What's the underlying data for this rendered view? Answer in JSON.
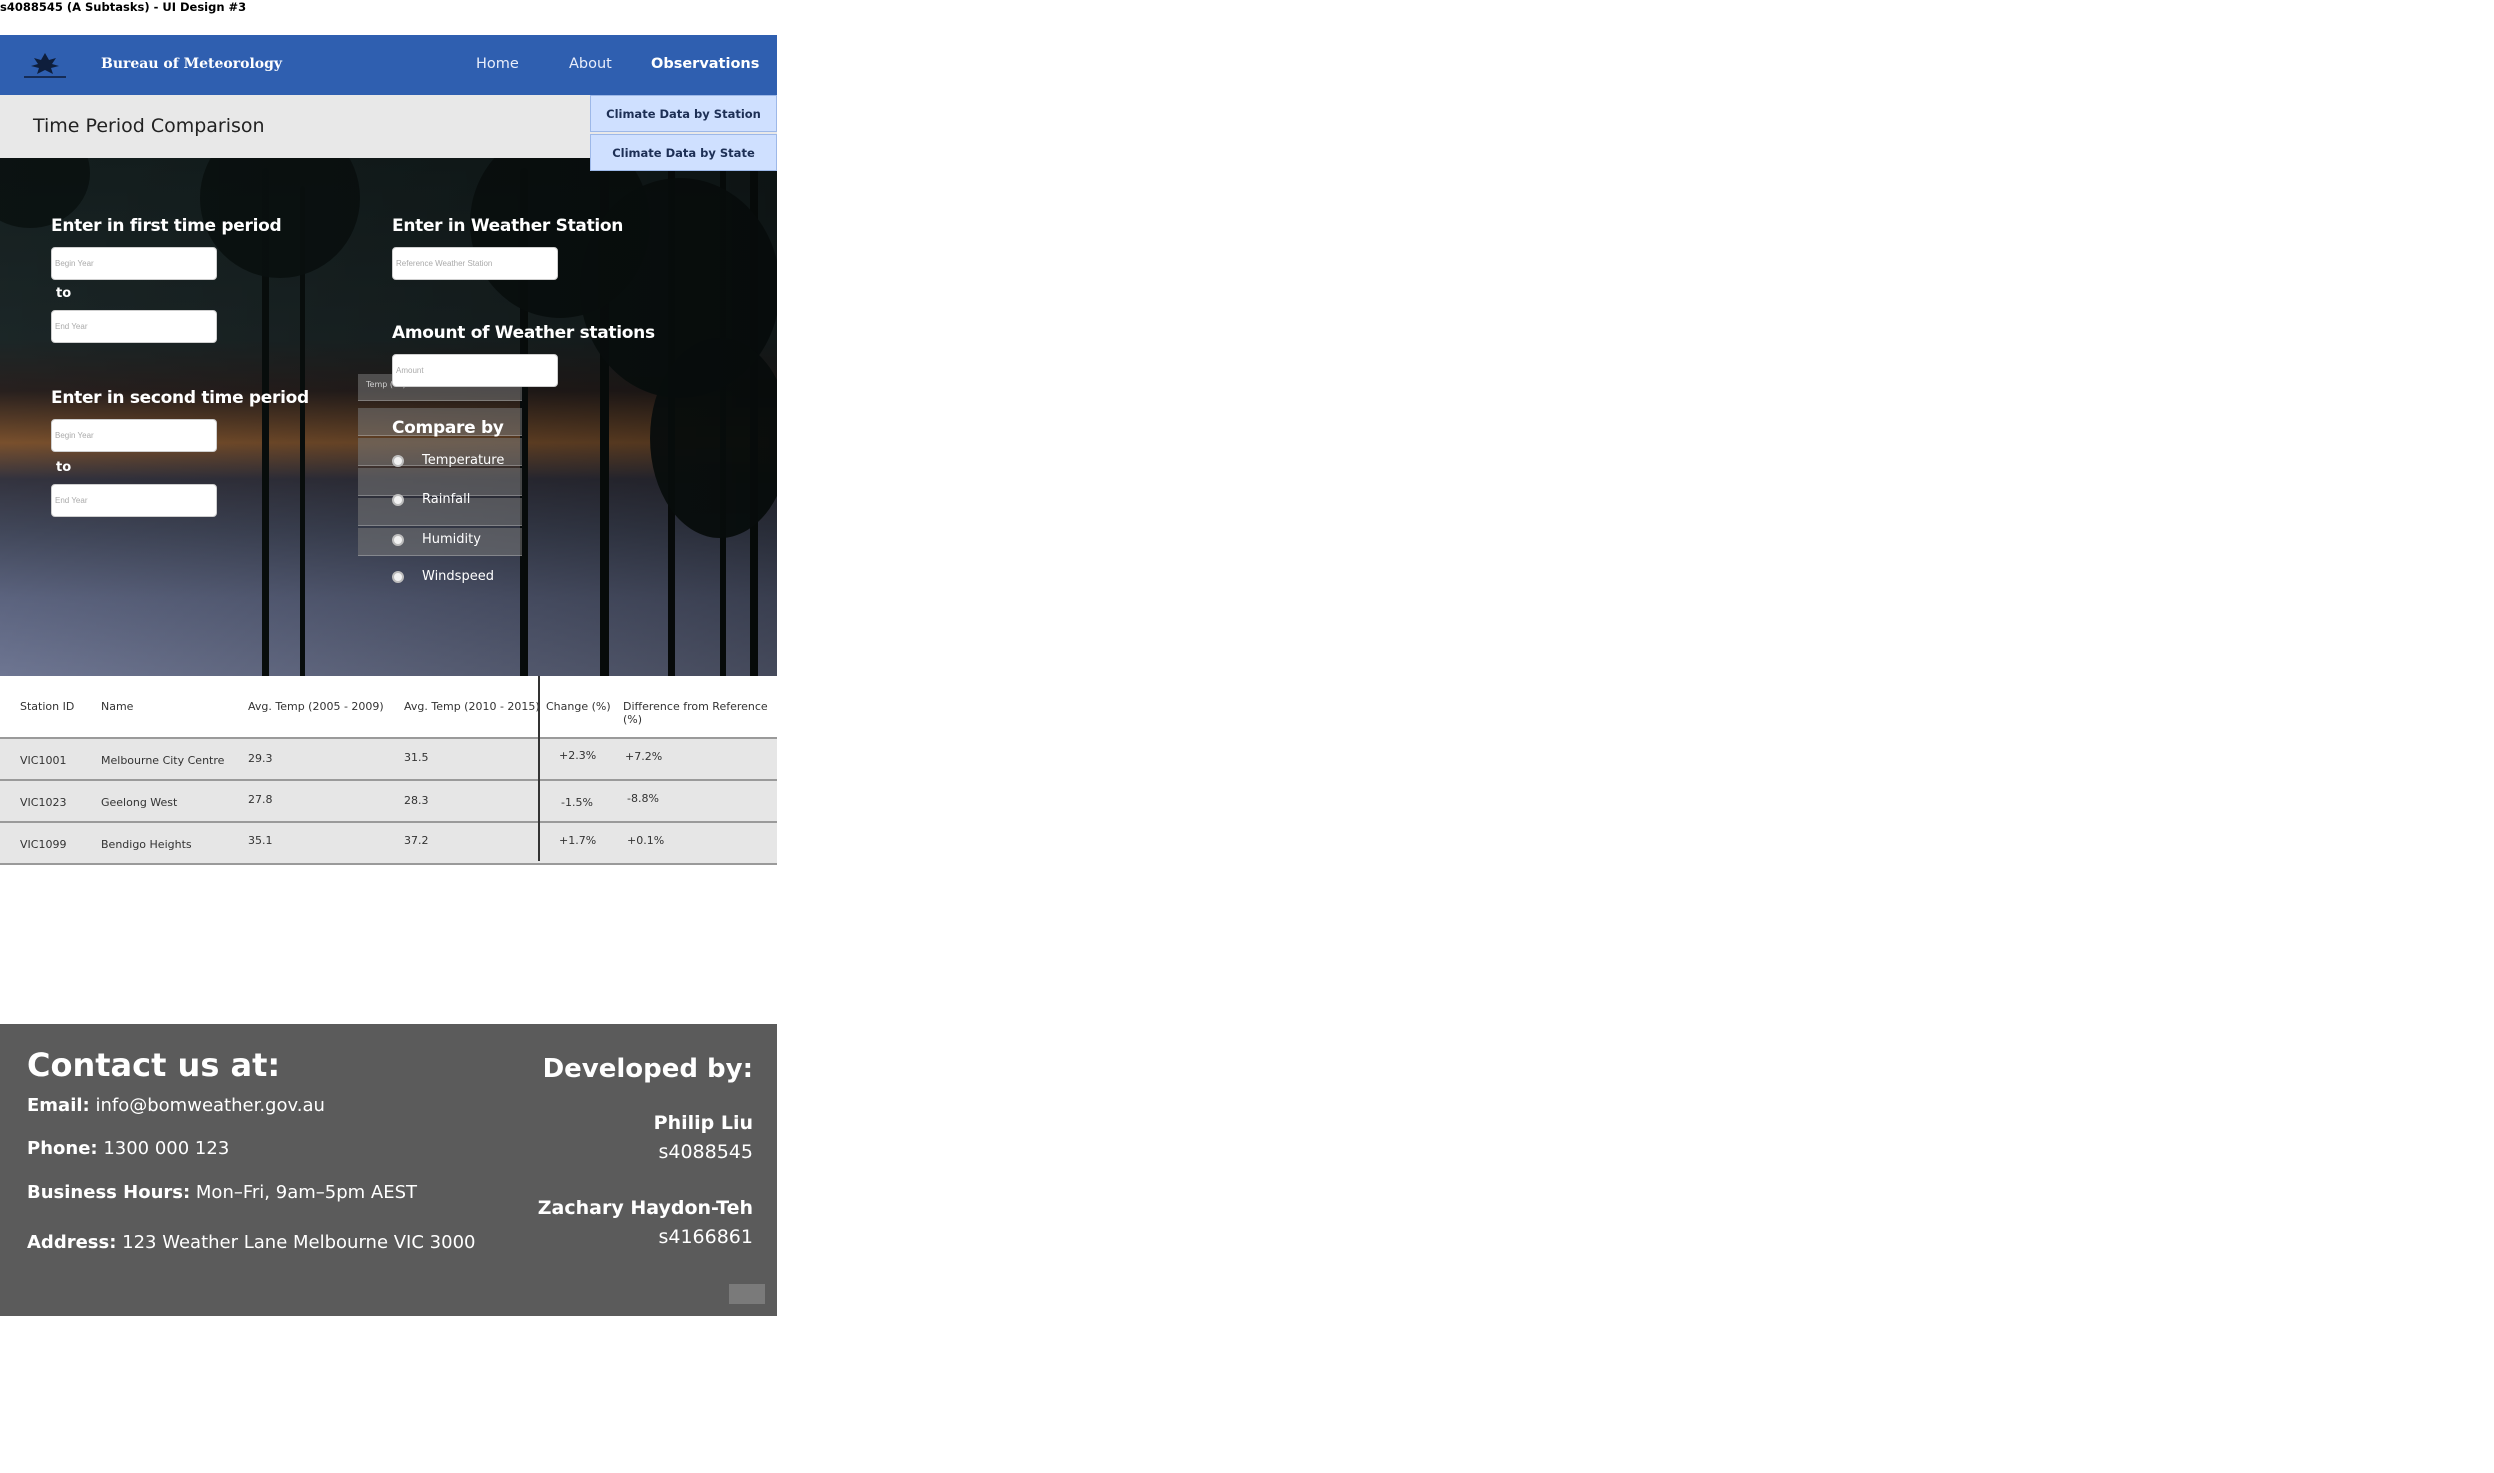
{
  "window_title": "s4088545 (A Subtasks) - UI Design #3",
  "nav": {
    "brand": "Bureau of Meteorology",
    "links": [
      "Home",
      "About",
      "Observations"
    ],
    "active": "Observations"
  },
  "page_title": "Time Period Comparison",
  "observations_menu": [
    "Climate Data by Station",
    "Climate Data by State"
  ],
  "form": {
    "first_period": {
      "heading": "Enter in first time period",
      "begin_placeholder": "Begin Year",
      "to_label": "to",
      "end_placeholder": "End Year"
    },
    "second_period": {
      "heading": "Enter in second time period",
      "begin_placeholder": "Begin Year",
      "to_label": "to",
      "end_placeholder": "End Year"
    },
    "station": {
      "heading": "Enter in Weather Station",
      "placeholder": "Reference Weather Station"
    },
    "amount": {
      "heading": "Amount of Weather stations",
      "placeholder": "Amount"
    },
    "compare_by": {
      "heading": "Compare by",
      "options": [
        "Temperature",
        "Rainfall",
        "Humidity",
        "Windspeed"
      ]
    },
    "ghost_hint": "Temp (°C)"
  },
  "table": {
    "headers": [
      "Station ID",
      "Name",
      "Avg. Temp (2005 - 2009)",
      "Avg. Temp (2010 - 2015)",
      "Change (%)",
      "Difference from Reference (%)"
    ],
    "rows": [
      [
        "VIC1001",
        "Melbourne City Centre",
        "29.3",
        "31.5",
        "+2.3%",
        "+7.2%"
      ],
      [
        "VIC1023",
        "Geelong West",
        "27.8",
        "28.3",
        "-1.5%",
        "-8.8%"
      ],
      [
        "VIC1099",
        "Bendigo Heights",
        "35.1",
        "37.2",
        "+1.7%",
        "+0.1%"
      ]
    ]
  },
  "footer": {
    "contact_heading": "Contact us at:",
    "email_label": "Email:",
    "email": "info@bomweather.gov.au",
    "phone_label": "Phone:",
    "phone": "1300 000 123",
    "hours_label": "Business Hours:",
    "hours": "Mon–Fri, 9am–5pm AEST",
    "address_label": "Address:",
    "address": "123 Weather Lane Melbourne VIC 3000",
    "developed_heading": "Developed by:",
    "developers": [
      {
        "name": "Philip Liu",
        "id": "s4088545"
      },
      {
        "name": "Zachary Haydon-Teh",
        "id": "s4166861"
      }
    ]
  },
  "colors": {
    "nav_bg": "#2f5fb0",
    "dropdown_bg": "#cfe0ff",
    "footer_bg": "#5b5b5b",
    "table_row_bg": "#e6e6e6"
  },
  "icons": [
    "crest-logo-icon",
    "radio-icon"
  ]
}
